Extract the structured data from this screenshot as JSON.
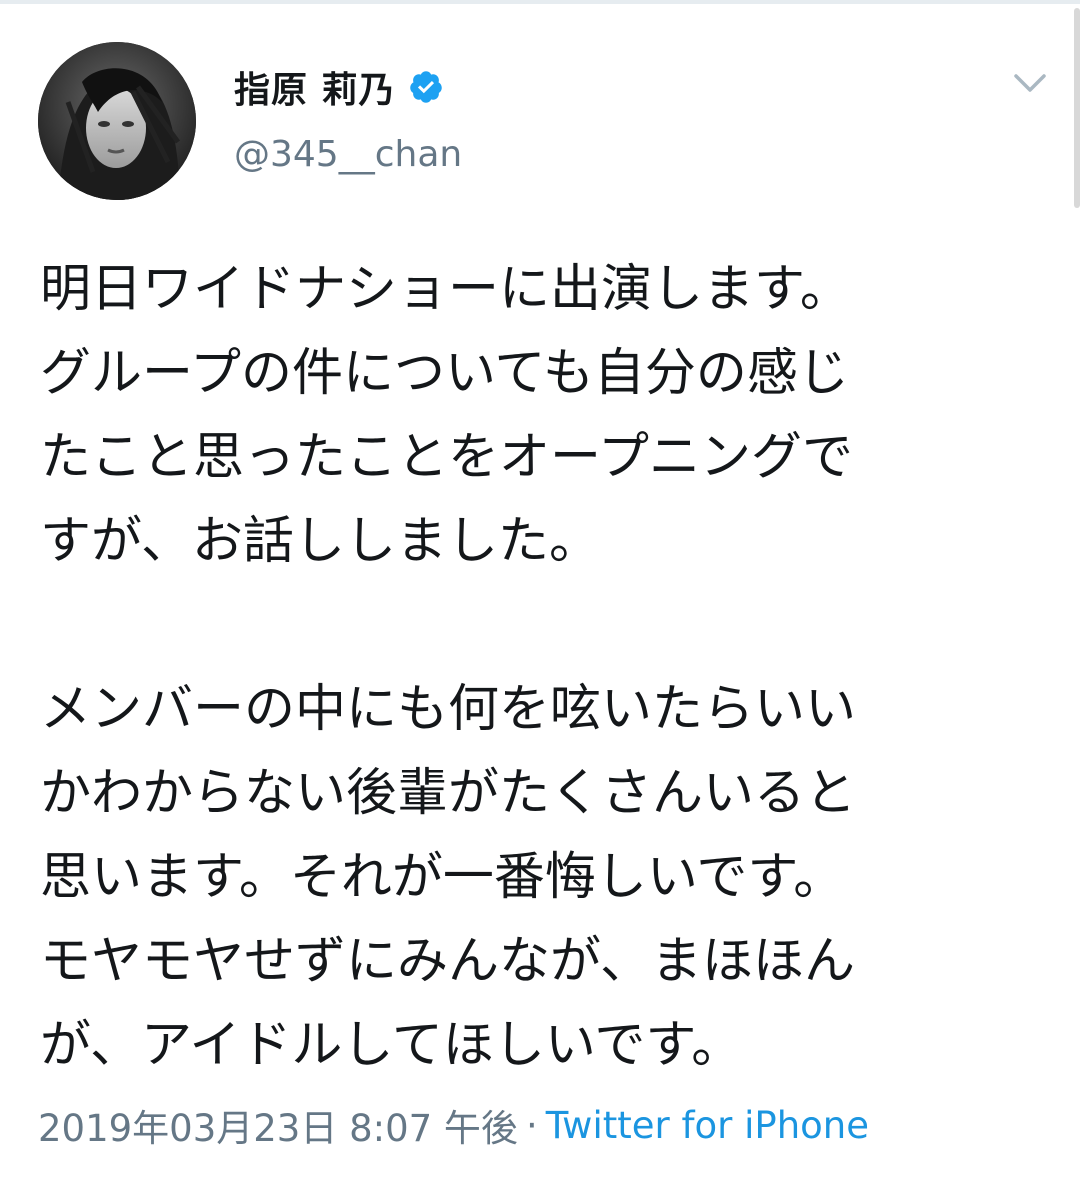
{
  "user": {
    "display_name": "指原 莉乃",
    "handle": "@345__chan",
    "verified": true,
    "avatar_icon": "profile-photo",
    "verified_icon": "verified-badge-icon"
  },
  "menu": {
    "icon": "chevron-down-icon"
  },
  "tweet": {
    "text": "明日ワイドナショーに出演します。\nグループの件についても自分の感じ\nたこと思ったことをオープニングで\nすが、お話ししました。\n\nメンバーの中にも何を呟いたらいい\nかわからない後輩がたくさんいると\n思います。それが一番悔しいです。\nモヤモヤせずにみんなが、まほほん\nが、アイドルしてほしいです。",
    "timestamp": "2019年03月23日 8:07 午後",
    "separator": "·",
    "source": "Twitter for iPhone"
  },
  "colors": {
    "text_primary": "#14171a",
    "text_secondary": "#657786",
    "link": "#1b95e0",
    "verified": "#1da1f2"
  }
}
